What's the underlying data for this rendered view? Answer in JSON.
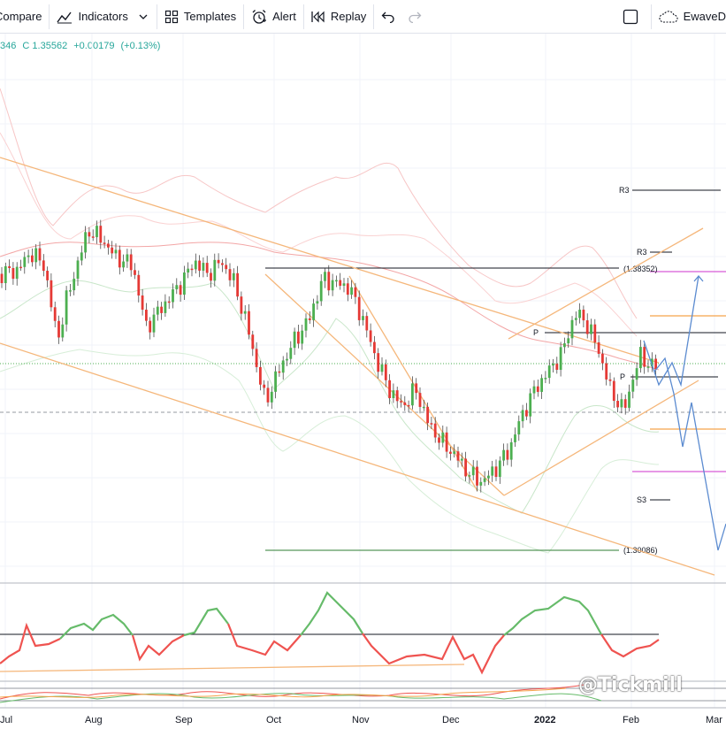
{
  "toolbar": {
    "compare_label": "Compare",
    "indicators_label": "Indicators",
    "templates_label": "Templates",
    "alert_label": "Alert",
    "replay_label": "Replay",
    "profile_label": "EwaveD"
  },
  "legend": {
    "low_partial": "346",
    "close": "C 1.35562",
    "change": "+0.00179",
    "change_pct": "(+0.13%)"
  },
  "levels": {
    "r3_upper": "R3",
    "r3_lower": "R3",
    "pivot_left": "P",
    "pivot_right": "P",
    "s3": "S3",
    "high_value": "(1.38352)",
    "low_value": "(1.30086)"
  },
  "axis": {
    "months": [
      "Jul",
      "Aug",
      "Sep",
      "Oct",
      "Nov",
      "Dec",
      "2022",
      "Feb",
      "Mar"
    ]
  },
  "watermark": "@Tickmill",
  "colors": {
    "up": "#26a69a",
    "down": "#ef5350",
    "bull_candle": "#4caf50",
    "bear_candle": "#e53935",
    "trendline": "#f5b77b",
    "forecast": "#5b8bd0",
    "pivot_magenta": "#d65bd6"
  }
}
